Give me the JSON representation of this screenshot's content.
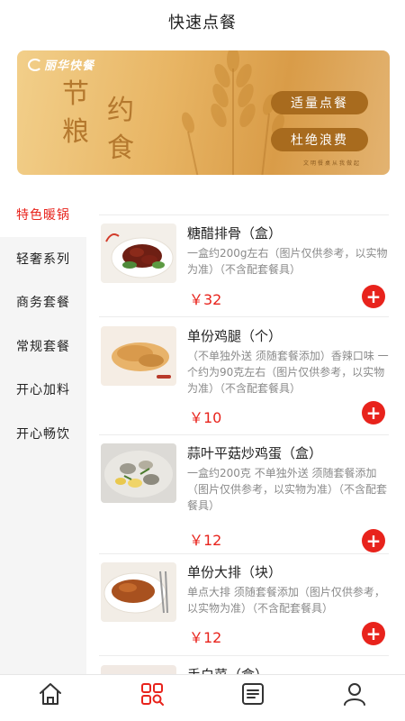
{
  "header": {
    "title": "快速点餐"
  },
  "banner": {
    "brand": "丽华快餐",
    "slogan_left": [
      "节",
      "粮"
    ],
    "slogan_right": [
      "约",
      "食"
    ],
    "pills": [
      "适量点餐",
      "杜绝浪费"
    ],
    "fine_print": "文明餐桌从我做起"
  },
  "sidebar": {
    "items": [
      {
        "label": "特色暖锅",
        "active": true
      },
      {
        "label": "轻奢系列"
      },
      {
        "label": "商务套餐"
      },
      {
        "label": "常规套餐"
      },
      {
        "label": "开心加料"
      },
      {
        "label": "开心畅饮"
      }
    ]
  },
  "menu": {
    "items": [
      {
        "name": "糖醋排骨（盒）",
        "desc": "一盒约200g左右（图片仅供参考，以实物为准）（不含配套餐具）",
        "price": "￥32",
        "add_icon": "plus-icon"
      },
      {
        "name": "单份鸡腿（个）",
        "desc": "（不单独外送 须随套餐添加）香辣口味 一个约为90克左右（图片仅供参考，以实物为准）（不含配套餐具）",
        "price": "￥10",
        "add_icon": "plus-icon"
      },
      {
        "name": "蒜叶平菇炒鸡蛋（盒）",
        "desc": "一盒约200克 不单独外送 须随套餐添加（图片仅供参考，以实物为准）（不含配套餐具）",
        "price": "￥12",
        "add_icon": "plus-icon"
      },
      {
        "name": "单份大排（块）",
        "desc": "单点大排 须随套餐添加（图片仅供参考，以实物为准）（不含配套餐具）",
        "price": "￥12",
        "add_icon": "plus-icon"
      },
      {
        "name": "手白菜（盒）",
        "desc": "",
        "price": "",
        "add_icon": "plus-icon"
      }
    ]
  },
  "tabbar": {
    "tabs": [
      {
        "icon": "home-icon"
      },
      {
        "icon": "order-search-icon",
        "active": true
      },
      {
        "icon": "list-icon"
      },
      {
        "icon": "user-icon"
      }
    ]
  },
  "colors": {
    "accent": "#e8231c",
    "banner_gold": "#a86b1e"
  }
}
